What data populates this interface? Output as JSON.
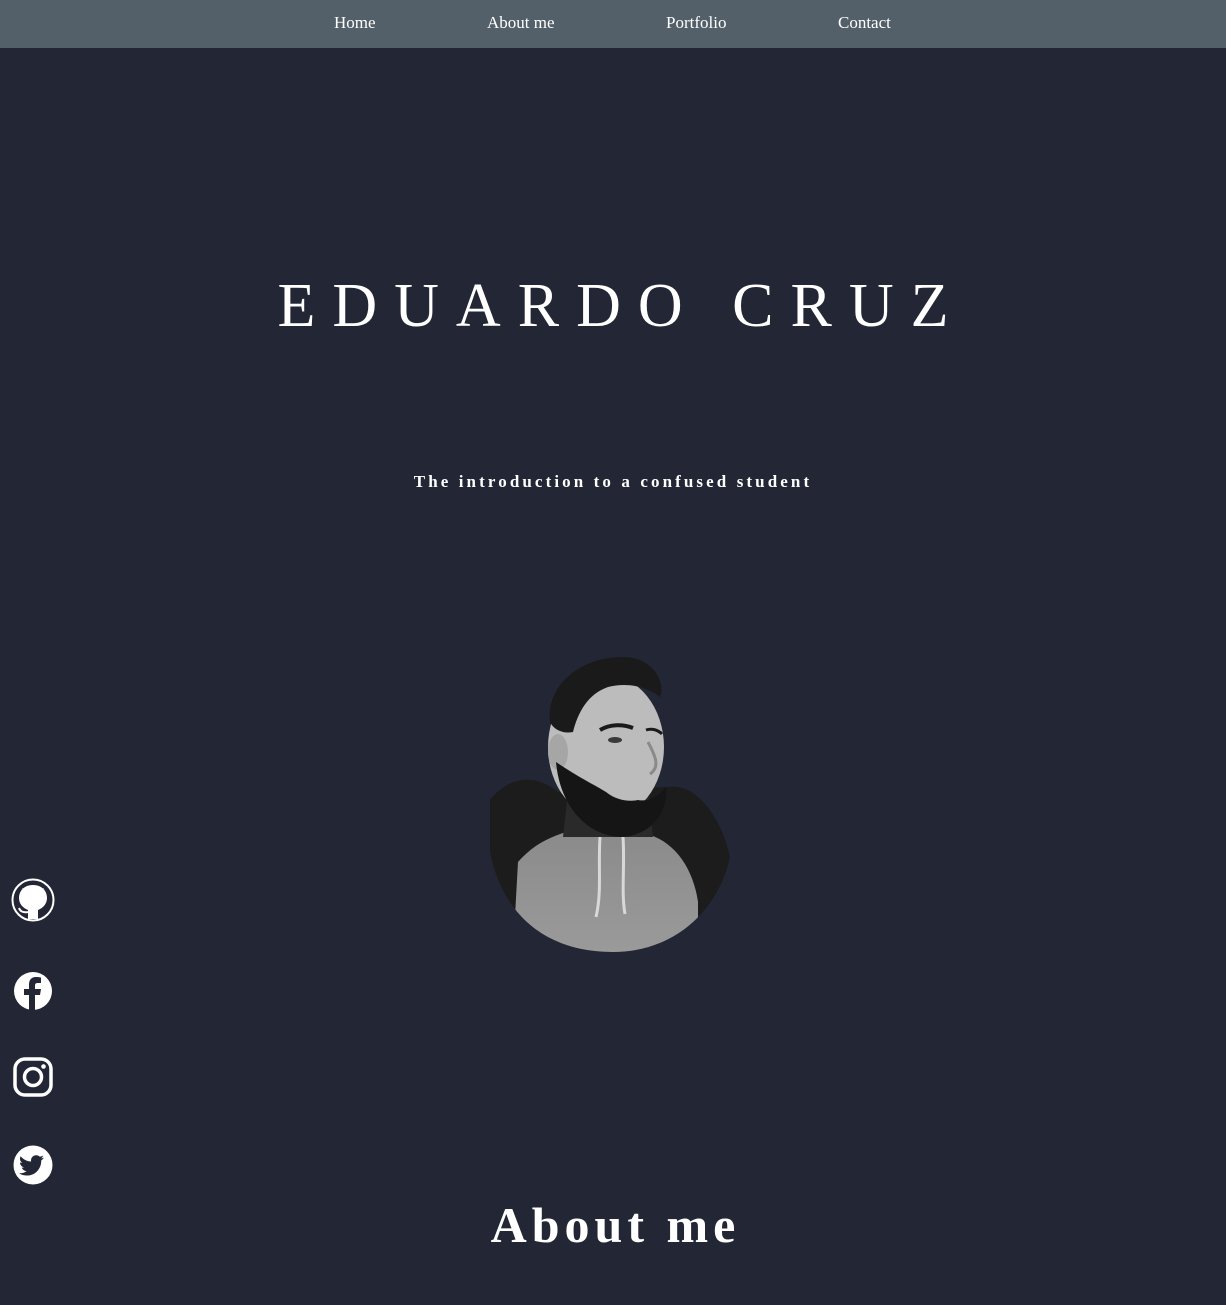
{
  "nav": {
    "items": [
      {
        "label": "Home"
      },
      {
        "label": "About me"
      },
      {
        "label": "Portfolio"
      },
      {
        "label": "Contact"
      }
    ]
  },
  "hero": {
    "name": "EDUARDO CRUZ",
    "tagline": "The introduction to a confused student"
  },
  "about": {
    "title": "About me"
  },
  "social": [
    {
      "icon": "github-icon"
    },
    {
      "icon": "facebook-icon"
    },
    {
      "icon": "instagram-icon"
    },
    {
      "icon": "twitter-icon"
    }
  ],
  "colors": {
    "background": "#232634",
    "navbar": "#535f69",
    "text": "#ffffff"
  }
}
